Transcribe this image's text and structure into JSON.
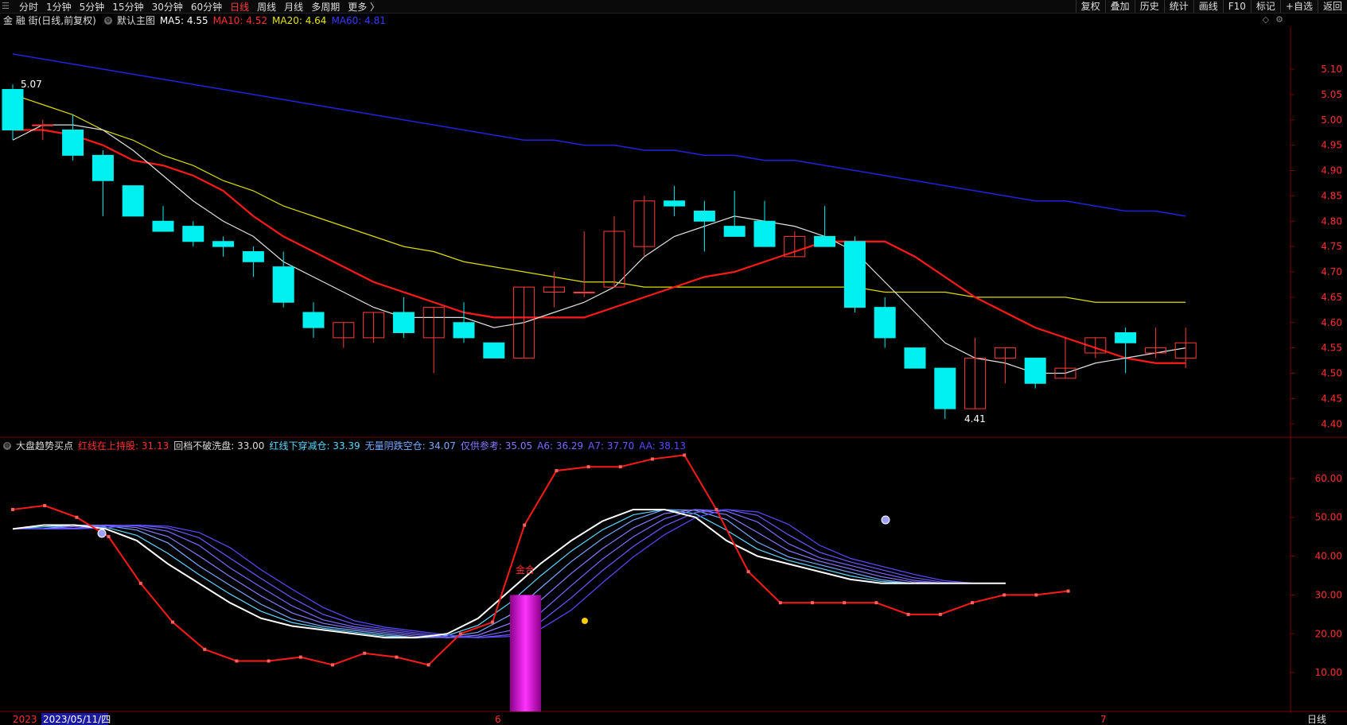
{
  "toolbar": {
    "periods": [
      "分时",
      "1分钟",
      "5分钟",
      "15分钟",
      "30分钟",
      "60分钟",
      "日线",
      "周线",
      "月线",
      "多周期",
      "更多 〉"
    ],
    "active_index": 6,
    "right_tools": [
      "复权",
      "叠加",
      "历史",
      "统计",
      "画线",
      "F10",
      "标记",
      "+自选",
      "返回"
    ]
  },
  "main_info": {
    "stock": "金 融 街(日线,前复权)",
    "template": "默认主图",
    "ma5": "MA5: 4.55",
    "ma10": "MA10: 4.52",
    "ma20": "MA20: 4.64",
    "ma60": "MA60: 4.81",
    "colors": {
      "ma5": "#ffffff",
      "ma10": "#ff2020",
      "ma20": "#e6e600",
      "ma60": "#2b2bff",
      "up": "#ff3b3b",
      "down": "#00f0f0"
    }
  },
  "sub_info": {
    "name": "大盘趋势买点",
    "l1": "红线在上持股: 31.13",
    "l2": "回档不破洗盘: 33.00",
    "l3": "红线下穿减仓: 33.39",
    "l4": "无量阴跌空仓: 34.07",
    "l5": "仅供参考: 35.05",
    "l6": "A6: 36.29",
    "l7": "A7: 37.70",
    "l8": "AA: 38.13",
    "signal": "金合"
  },
  "annotations": {
    "high": "5.07",
    "low": "4.41"
  },
  "axis": {
    "main_ticks": [
      "5.10",
      "5.05",
      "5.00",
      "4.95",
      "4.90",
      "4.85",
      "4.80",
      "4.75",
      "4.70",
      "4.65",
      "4.60",
      "4.55",
      "4.50",
      "4.45",
      "4.40"
    ],
    "sub_ticks": [
      "60.00",
      "50.00",
      "40.00",
      "30.00",
      "20.00",
      "10.00"
    ],
    "date_start": "2023",
    "date_cursor": "2023/05/11/四",
    "month_6": "6",
    "month_7": "7",
    "period_label": "日线"
  },
  "chart_data": {
    "type": "candlestick",
    "candles": [
      [
        5.06,
        4.98,
        5.07,
        4.96
      ],
      [
        4.99,
        4.99,
        5.0,
        4.96
      ],
      [
        4.98,
        4.93,
        5.01,
        4.92
      ],
      [
        4.93,
        4.88,
        4.94,
        4.81
      ],
      [
        4.87,
        4.81,
        4.87,
        4.81
      ],
      [
        4.8,
        4.78,
        4.83,
        4.78
      ],
      [
        4.79,
        4.76,
        4.8,
        4.75
      ],
      [
        4.76,
        4.75,
        4.77,
        4.73
      ],
      [
        4.74,
        4.72,
        4.75,
        4.69
      ],
      [
        4.71,
        4.64,
        4.74,
        4.63
      ],
      [
        4.62,
        4.59,
        4.64,
        4.57
      ],
      [
        4.57,
        4.6,
        4.6,
        4.55
      ],
      [
        4.57,
        4.62,
        4.62,
        4.56
      ],
      [
        4.62,
        4.58,
        4.65,
        4.57
      ],
      [
        4.57,
        4.63,
        4.63,
        4.5
      ],
      [
        4.6,
        4.57,
        4.64,
        4.56
      ],
      [
        4.56,
        4.53,
        4.56,
        4.53
      ],
      [
        4.53,
        4.67,
        4.67,
        4.53
      ],
      [
        4.66,
        4.67,
        4.7,
        4.63
      ],
      [
        4.66,
        4.66,
        4.78,
        4.65
      ],
      [
        4.67,
        4.78,
        4.81,
        4.67
      ],
      [
        4.75,
        4.84,
        4.85,
        4.73
      ],
      [
        4.84,
        4.83,
        4.87,
        4.81
      ],
      [
        4.82,
        4.8,
        4.84,
        4.74
      ],
      [
        4.79,
        4.77,
        4.86,
        4.77
      ],
      [
        4.8,
        4.75,
        4.84,
        4.75
      ],
      [
        4.73,
        4.77,
        4.78,
        4.73
      ],
      [
        4.77,
        4.75,
        4.83,
        4.75
      ],
      [
        4.76,
        4.63,
        4.77,
        4.62
      ],
      [
        4.63,
        4.57,
        4.65,
        4.55
      ],
      [
        4.55,
        4.51,
        4.55,
        4.51
      ],
      [
        4.51,
        4.43,
        4.51,
        4.41
      ],
      [
        4.43,
        4.53,
        4.57,
        4.43
      ],
      [
        4.53,
        4.55,
        4.55,
        4.48
      ],
      [
        4.53,
        4.48,
        4.53,
        4.47
      ],
      [
        4.49,
        4.51,
        4.57,
        4.49
      ],
      [
        4.54,
        4.57,
        4.57,
        4.53
      ],
      [
        4.58,
        4.56,
        4.59,
        4.5
      ],
      [
        4.54,
        4.55,
        4.59,
        4.53
      ],
      [
        4.53,
        4.56,
        4.59,
        4.51
      ]
    ],
    "ma5": [
      4.96,
      4.99,
      4.99,
      4.98,
      4.94,
      4.89,
      4.84,
      4.8,
      4.77,
      4.72,
      4.69,
      4.66,
      4.63,
      4.61,
      4.61,
      4.61,
      4.59,
      4.6,
      4.62,
      4.64,
      4.67,
      4.73,
      4.77,
      4.79,
      4.81,
      4.8,
      4.79,
      4.77,
      4.74,
      4.68,
      4.62,
      4.56,
      4.53,
      4.52,
      4.5,
      4.5,
      4.52,
      4.53,
      4.54,
      4.55
    ],
    "ma10": [
      4.98,
      4.98,
      4.97,
      4.95,
      4.92,
      4.91,
      4.89,
      4.86,
      4.81,
      4.77,
      4.74,
      4.71,
      4.68,
      4.66,
      4.64,
      4.62,
      4.61,
      4.61,
      4.61,
      4.61,
      4.63,
      4.65,
      4.67,
      4.69,
      4.7,
      4.72,
      4.74,
      4.76,
      4.76,
      4.76,
      4.73,
      4.69,
      4.65,
      4.62,
      4.59,
      4.57,
      4.55,
      4.53,
      4.52,
      4.52
    ],
    "ma20": [
      5.05,
      5.03,
      5.01,
      4.98,
      4.96,
      4.93,
      4.91,
      4.88,
      4.86,
      4.83,
      4.81,
      4.79,
      4.77,
      4.75,
      4.74,
      4.72,
      4.71,
      4.7,
      4.69,
      4.68,
      4.68,
      4.67,
      4.67,
      4.67,
      4.67,
      4.67,
      4.67,
      4.67,
      4.67,
      4.66,
      4.66,
      4.66,
      4.65,
      4.65,
      4.65,
      4.65,
      4.64,
      4.64,
      4.64,
      4.64
    ],
    "ma60": [
      5.13,
      5.12,
      5.11,
      5.1,
      5.09,
      5.08,
      5.07,
      5.06,
      5.05,
      5.04,
      5.03,
      5.02,
      5.01,
      5.0,
      4.99,
      4.98,
      4.97,
      4.96,
      4.96,
      4.95,
      4.95,
      4.94,
      4.94,
      4.93,
      4.93,
      4.92,
      4.92,
      4.91,
      4.9,
      4.89,
      4.88,
      4.87,
      4.86,
      4.85,
      4.84,
      4.84,
      4.83,
      4.82,
      4.82,
      4.81
    ],
    "red_line": [
      52,
      53,
      50,
      45,
      33,
      23,
      16,
      13,
      13,
      14,
      12,
      15,
      14,
      12,
      20,
      23,
      48,
      62,
      63,
      63,
      65,
      66,
      52,
      36,
      28,
      28,
      28,
      28,
      25,
      25,
      28,
      30,
      30,
      31
    ],
    "white_line": [
      47,
      48,
      48,
      47,
      44,
      38,
      33,
      28,
      24,
      22,
      21,
      20,
      19,
      19,
      20,
      24,
      31,
      38,
      44,
      49,
      52,
      52,
      50,
      44,
      40,
      38,
      36,
      34,
      33,
      33,
      33,
      33,
      33
    ],
    "ylim_main": [
      4.38,
      5.18
    ],
    "ylim_sub": [
      0,
      70
    ]
  }
}
